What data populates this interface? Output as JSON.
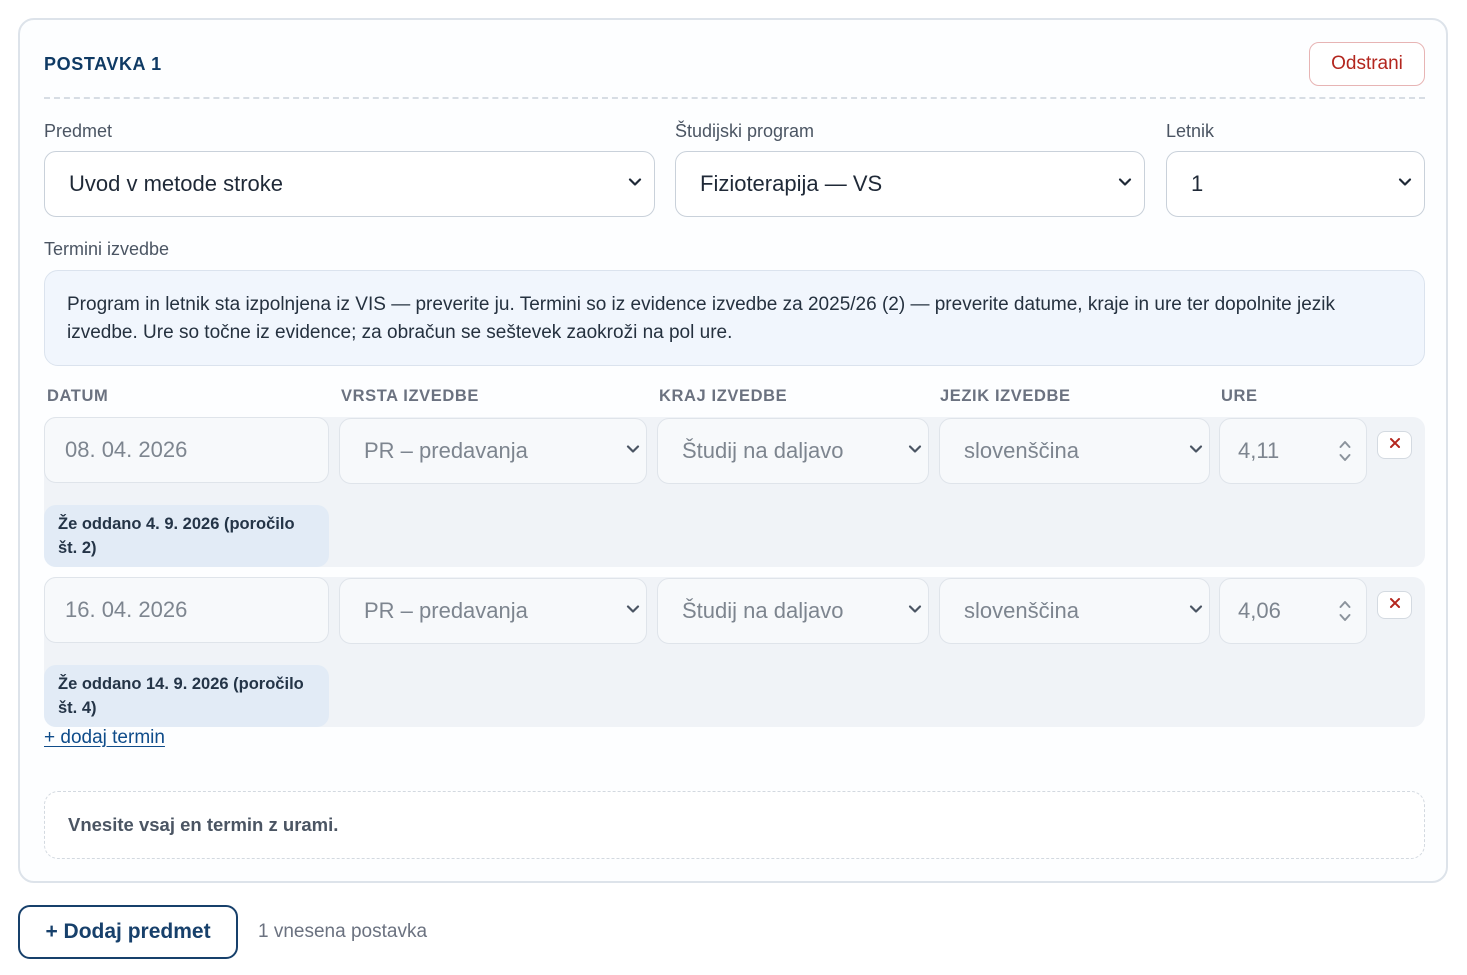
{
  "item": {
    "title": "POSTAVKA 1",
    "remove_label": "Odstrani"
  },
  "fields": {
    "subject_label": "Predmet",
    "subject_value": "Uvod v metode stroke",
    "program_label": "Študijski program",
    "program_value": "Fizioterapija — VS",
    "year_label": "Letnik",
    "year_value": "1"
  },
  "terms": {
    "section_label": "Termini izvedbe",
    "info_text": "Program in letnik sta izpolnjena iz VIS — preverite ju. Termini so iz evidence izvedbe za 2025/26 (2) — preverite datume, kraje in ure ter dopolnite jezik izvedbe. Ure so točne iz evidence; za obračun se seštevek zaokroži na pol ure.",
    "columns": [
      "DATUM",
      "VRSTA IZVEDBE",
      "KRAJ IZVEDBE",
      "JEZIK IZVEDBE",
      "URE"
    ],
    "rows": [
      {
        "date": "08. 04. 2026",
        "type": "PR – predavanja",
        "place": "Študij na daljavo",
        "language": "slovenščina",
        "hours": "4,11",
        "status": "Že oddano 4. 9. 2026 (poročilo št. 2)"
      },
      {
        "date": "16. 04. 2026",
        "type": "PR – predavanja",
        "place": "Študij na daljavo",
        "language": "slovenščina",
        "hours": "4,06",
        "status": "Že oddano 14. 9. 2026 (poročilo št. 4)"
      }
    ],
    "add_term_label": "+ dodaj termin",
    "warning_text": "Vnesite vsaj en termin z urami."
  },
  "footer": {
    "add_subject_label": "+ Dodaj predmet",
    "count_text": "1 vnesena postavka"
  },
  "icons": {
    "chevron": "chevron-down-icon",
    "close": "close-icon",
    "stepper": "stepper-icon"
  },
  "colors": {
    "accent": "#0f3a64",
    "danger": "#b3261e",
    "link": "#0f4c8a",
    "info_bg": "#f1f6fd",
    "row_bg": "#f0f3f7",
    "badge_bg": "#e2ebf6"
  }
}
